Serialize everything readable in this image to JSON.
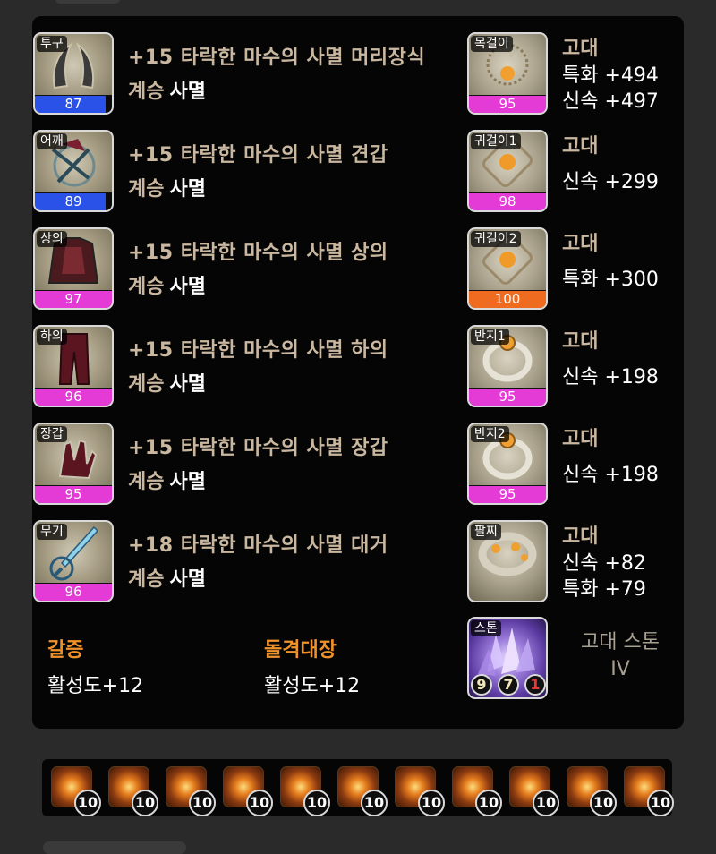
{
  "equipment": [
    {
      "slot": "투구",
      "name": "+15 타락한 마수의 사멸 머리장식",
      "tier_label": "계승",
      "tier_value": "사멸",
      "quality": "87",
      "quality_color": "blue",
      "icon": "helmet-icon"
    },
    {
      "slot": "어깨",
      "name": "+15 타락한 마수의 사멸 견갑",
      "tier_label": "계승",
      "tier_value": "사멸",
      "quality": "89",
      "quality_color": "blue",
      "icon": "shoulder-icon"
    },
    {
      "slot": "상의",
      "name": "+15 타락한 마수의 사멸 상의",
      "tier_label": "계승",
      "tier_value": "사멸",
      "quality": "97",
      "quality_color": "pink",
      "icon": "chest-armor-icon"
    },
    {
      "slot": "하의",
      "name": "+15 타락한 마수의 사멸 하의",
      "tier_label": "계승",
      "tier_value": "사멸",
      "quality": "96",
      "quality_color": "pink",
      "icon": "pants-icon"
    },
    {
      "slot": "장갑",
      "name": "+15 타락한 마수의 사멸 장갑",
      "tier_label": "계승",
      "tier_value": "사멸",
      "quality": "95",
      "quality_color": "pink",
      "icon": "gloves-icon"
    },
    {
      "slot": "무기",
      "name": "+18 타락한 마수의 사멸 대거",
      "tier_label": "계승",
      "tier_value": "사멸",
      "quality": "96",
      "quality_color": "pink",
      "icon": "dagger-icon"
    }
  ],
  "accessories": [
    {
      "slot": "목걸이",
      "grade": "고대",
      "stats": [
        "특화 +494",
        "신속 +497"
      ],
      "quality": "95",
      "quality_color": "pink",
      "icon": "necklace-icon"
    },
    {
      "slot": "귀걸이1",
      "grade": "고대",
      "stats": [
        "신속 +299"
      ],
      "quality": "98",
      "quality_color": "pink",
      "icon": "earring-icon"
    },
    {
      "slot": "귀걸이2",
      "grade": "고대",
      "stats": [
        "특화 +300"
      ],
      "quality": "100",
      "quality_color": "orange",
      "icon": "earring-icon"
    },
    {
      "slot": "반지1",
      "grade": "고대",
      "stats": [
        "신속 +198"
      ],
      "quality": "95",
      "quality_color": "pink",
      "icon": "ring-icon"
    },
    {
      "slot": "반지2",
      "grade": "고대",
      "stats": [
        "신속 +198"
      ],
      "quality": "95",
      "quality_color": "pink",
      "icon": "ring-icon"
    },
    {
      "slot": "팔찌",
      "grade": "고대",
      "stats": [
        "신속 +82",
        "특화 +79"
      ],
      "icon": "bracelet-icon"
    }
  ],
  "engravings": [
    {
      "name": "갈증",
      "value": "활성도+12"
    },
    {
      "name": "돌격대장",
      "value": "활성도+12"
    }
  ],
  "stone": {
    "slot": "스톤",
    "label_line1": "고대 스톤",
    "label_line2": "IV",
    "levels": [
      "9",
      "7",
      "1"
    ],
    "level_colors": [
      "#f2e6b8",
      "#f2e6b8",
      "#e23b3b"
    ],
    "icon": "ability-stone-icon"
  },
  "gems": {
    "levels": [
      "10",
      "10",
      "10",
      "10",
      "10",
      "10",
      "10",
      "10",
      "10",
      "10",
      "10"
    ],
    "icon": "gem-icon"
  }
}
